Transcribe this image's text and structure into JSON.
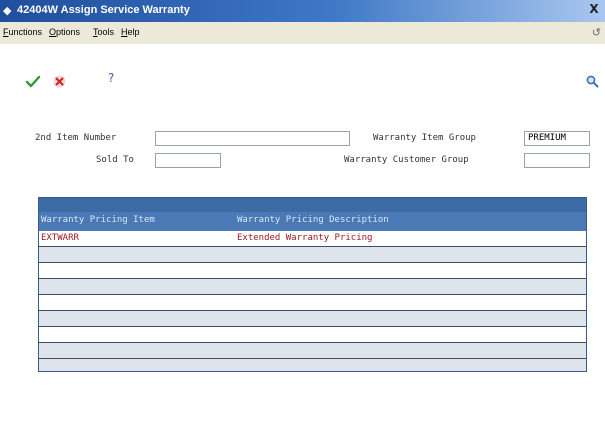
{
  "window": {
    "title": "42404W  Assign Service Warranty",
    "close_glyph": "X"
  },
  "menu": {
    "items": [
      "Functions",
      "Options",
      "Tools",
      "Help"
    ]
  },
  "toolbar": {
    "ok_icon": "checkmark-icon",
    "cancel_icon": "cancel-x-icon",
    "help_label": "?",
    "search_icon": "magnifier-icon"
  },
  "form": {
    "item_number_label": "2nd Item Number",
    "item_number_value": "",
    "sold_to_label": "Sold To",
    "sold_to_value": "",
    "warranty_item_group_label": "Warranty Item Group",
    "warranty_item_group_value": "PREMIUM",
    "warranty_customer_group_label": "Warranty Customer Group",
    "warranty_customer_group_value": ""
  },
  "grid": {
    "columns": [
      "Warranty Pricing Item",
      "Warranty Pricing Description"
    ],
    "rows": [
      [
        "EXTWARR",
        "Extended Warranty Pricing"
      ],
      [
        "",
        ""
      ],
      [
        "",
        ""
      ],
      [
        "",
        ""
      ],
      [
        "",
        ""
      ],
      [
        "",
        ""
      ],
      [
        "",
        ""
      ],
      [
        "",
        ""
      ]
    ]
  },
  "colors": {
    "title_bar": "#1f4e9c",
    "grid_header": "#4a79b5",
    "row_text": "#a01822"
  }
}
